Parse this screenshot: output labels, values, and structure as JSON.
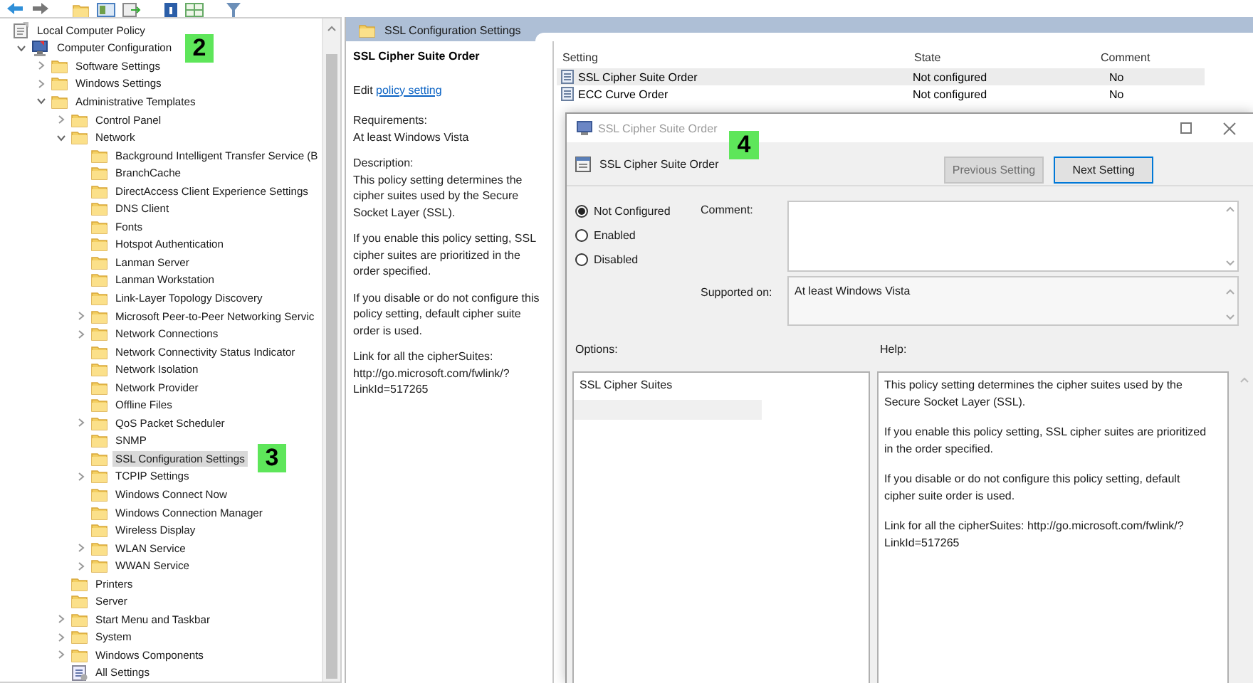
{
  "tree": [
    {
      "label": "Local Computer Policy",
      "kind": "policy",
      "selected": false,
      "children": [
        {
          "label": "Computer Configuration",
          "kind": "computer",
          "expanded": true,
          "selected": false,
          "callout": "2",
          "children": [
            {
              "label": "Software Settings",
              "kind": "folder",
              "expanded": false,
              "selected": false
            },
            {
              "label": "Windows Settings",
              "kind": "folder",
              "expanded": false,
              "selected": false
            },
            {
              "label": "Administrative Templates",
              "kind": "folder",
              "expanded": true,
              "selected": false,
              "children": [
                {
                  "label": "Control Panel",
                  "kind": "folder",
                  "expanded": false,
                  "selected": false
                },
                {
                  "label": "Network",
                  "kind": "folder",
                  "expanded": true,
                  "selected": false,
                  "children": [
                    {
                      "label": "Background Intelligent Transfer Service (B",
                      "kind": "folder",
                      "selected": false
                    },
                    {
                      "label": "BranchCache",
                      "kind": "folder",
                      "selected": false
                    },
                    {
                      "label": "DirectAccess Client Experience Settings",
                      "kind": "folder",
                      "selected": false
                    },
                    {
                      "label": "DNS Client",
                      "kind": "folder",
                      "selected": false
                    },
                    {
                      "label": "Fonts",
                      "kind": "folder",
                      "selected": false
                    },
                    {
                      "label": "Hotspot Authentication",
                      "kind": "folder",
                      "selected": false
                    },
                    {
                      "label": "Lanman Server",
                      "kind": "folder",
                      "selected": false
                    },
                    {
                      "label": "Lanman Workstation",
                      "kind": "folder",
                      "selected": false
                    },
                    {
                      "label": "Link-Layer Topology Discovery",
                      "kind": "folder",
                      "selected": false
                    },
                    {
                      "label": "Microsoft Peer-to-Peer Networking Servic",
                      "kind": "folder",
                      "expanded": false,
                      "selected": false
                    },
                    {
                      "label": "Network Connections",
                      "kind": "folder",
                      "expanded": false,
                      "selected": false
                    },
                    {
                      "label": "Network Connectivity Status Indicator",
                      "kind": "folder",
                      "selected": false
                    },
                    {
                      "label": "Network Isolation",
                      "kind": "folder",
                      "selected": false
                    },
                    {
                      "label": "Network Provider",
                      "kind": "folder",
                      "selected": false
                    },
                    {
                      "label": "Offline Files",
                      "kind": "folder",
                      "selected": false
                    },
                    {
                      "label": "QoS Packet Scheduler",
                      "kind": "folder",
                      "expanded": false,
                      "selected": false
                    },
                    {
                      "label": "SNMP",
                      "kind": "folder",
                      "selected": false
                    },
                    {
                      "label": "SSL Configuration Settings",
                      "kind": "folder",
                      "selected": true,
                      "callout": "3"
                    },
                    {
                      "label": "TCPIP Settings",
                      "kind": "folder",
                      "expanded": false,
                      "selected": false
                    },
                    {
                      "label": "Windows Connect Now",
                      "kind": "folder",
                      "selected": false
                    },
                    {
                      "label": "Windows Connection Manager",
                      "kind": "folder",
                      "selected": false
                    },
                    {
                      "label": "Wireless Display",
                      "kind": "folder",
                      "selected": false
                    },
                    {
                      "label": "WLAN Service",
                      "kind": "folder",
                      "expanded": false,
                      "selected": false
                    },
                    {
                      "label": "WWAN Service",
                      "kind": "folder",
                      "expanded": false,
                      "selected": false
                    }
                  ]
                },
                {
                  "label": "Printers",
                  "kind": "folder",
                  "selected": false
                },
                {
                  "label": "Server",
                  "kind": "folder",
                  "selected": false
                },
                {
                  "label": "Start Menu and Taskbar",
                  "kind": "folder",
                  "expanded": false,
                  "selected": false
                },
                {
                  "label": "System",
                  "kind": "folder",
                  "expanded": false,
                  "selected": false
                },
                {
                  "label": "Windows Components",
                  "kind": "folder",
                  "expanded": false,
                  "selected": false
                },
                {
                  "label": "All Settings",
                  "kind": "settings",
                  "selected": false
                }
              ]
            }
          ]
        }
      ]
    }
  ],
  "details": {
    "tab_title": "SSL Configuration Settings",
    "title": "SSL Cipher Suite Order",
    "edit_prefix": "Edit",
    "edit_link": "policy setting",
    "requirements_label": "Requirements:",
    "requirements": "At least Windows Vista",
    "description_label": "Description:",
    "paragraphs": [
      "This policy setting determines the cipher suites used by the Secure Socket Layer (SSL).",
      "If you enable this policy setting, SSL cipher suites are prioritized in the order specified.",
      "If you disable or do not configure this policy setting, default cipher suite order is used.",
      "Link for all the cipherSuites: http://go.microsoft.com/fwlink/?\nLinkId=517265"
    ]
  },
  "settings_table": {
    "columns": [
      "Setting",
      "State",
      "Comment"
    ],
    "rows": [
      {
        "cells": [
          "SSL Cipher Suite Order",
          "Not configured",
          "No"
        ],
        "selected": true
      },
      {
        "cells": [
          "ECC Curve Order",
          "Not configured",
          "No"
        ],
        "selected": false
      }
    ]
  },
  "dialog": {
    "title": "SSL Cipher Suite Order",
    "callout": "4",
    "heading": "SSL Cipher Suite Order",
    "buttons": [
      {
        "label": "Previous Setting",
        "disabled": true
      },
      {
        "label": "Next Setting",
        "disabled": false
      }
    ],
    "options": [
      {
        "label": "Not Configured",
        "selected": true
      },
      {
        "label": "Enabled",
        "selected": false
      },
      {
        "label": "Disabled",
        "selected": false
      }
    ],
    "comment_label": "Comment:",
    "supported_label": "Supported on:",
    "supported_value": "At least Windows Vista",
    "options_label": "Options:",
    "help_label": "Help:",
    "option_items": [
      "SSL Cipher Suites"
    ],
    "help_paragraphs": [
      "This policy setting determines the cipher suites used by the Secure Socket Layer (SSL).",
      "If you enable this policy setting, SSL cipher suites are prioritized in the order specified.",
      "If you disable or do not configure this policy setting, default cipher suite order is used.",
      "Link for all the cipherSuites: http://go.microsoft.com/fwlink/?\nLinkId=517265"
    ]
  }
}
